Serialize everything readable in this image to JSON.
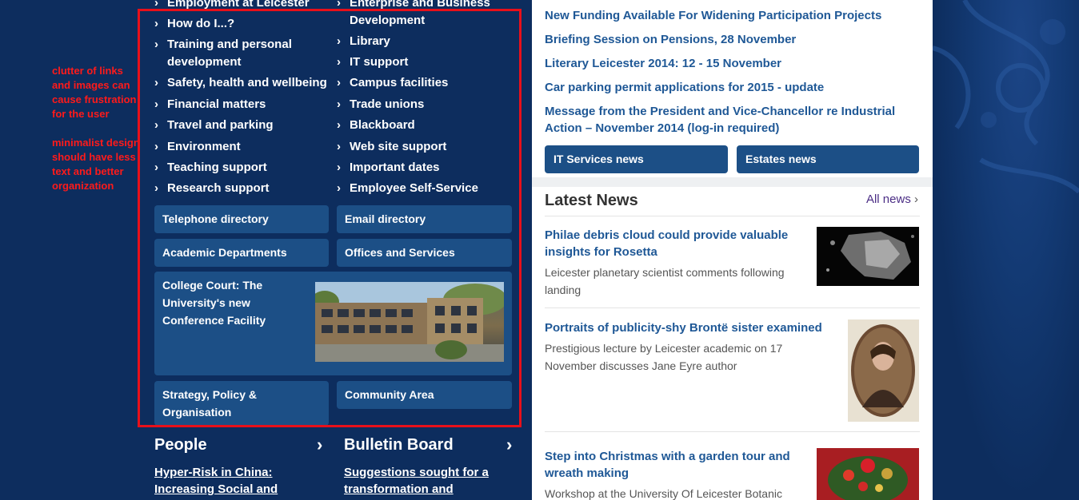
{
  "annotations": {
    "note1": "clutter of links and images can cause frustration for the user",
    "note2": "minimalist design should have less text and better organization"
  },
  "quick_links": {
    "left": [
      "Employment at Leicester",
      "How do I...?",
      "Training and personal development",
      "Safety, health and wellbeing",
      "Financial matters",
      "Travel and parking",
      "Environment",
      "Teaching support",
      "Research support"
    ],
    "right": [
      "Enterprise and Business Development",
      "Library",
      "IT support",
      "Campus facilities",
      "Trade unions",
      "Blackboard",
      "Web site support",
      "Important dates",
      "Employee Self-Service"
    ]
  },
  "tiles": {
    "telephone": "Telephone directory",
    "email": "Email directory",
    "academic": "Academic Departments",
    "offices": "Offices and Services",
    "college_court": "College Court: The University's new Conference Facility",
    "strategy": "Strategy, Policy & Organisation",
    "community": "Community Area"
  },
  "sections": {
    "people_title": "People",
    "people_link": "Hyper-Risk in China: Increasing Social and",
    "bulletin_title": "Bulletin Board",
    "bulletin_link": "Suggestions sought for a transformation and"
  },
  "announcements": [
    "New Funding Available For Widening Participation Projects",
    "Briefing Session on Pensions, 28 November",
    "Literary Leicester 2014: 12 - 15 November",
    "Car parking permit applications for 2015 - update",
    "Message from the President and Vice-Chancellor re Industrial Action – November 2014 (log-in required)"
  ],
  "news_buttons": {
    "it": "IT Services news",
    "estates": "Estates news"
  },
  "latest_news": {
    "title": "Latest News",
    "all_news": "All news",
    "items": [
      {
        "title": "Philae debris cloud could provide valuable insights for Rosetta",
        "desc": "Leicester planetary scientist comments following landing"
      },
      {
        "title": "Portraits of publicity-shy Brontë sister examined",
        "desc": "Prestigious lecture by Leicester academic on 17 November discusses Jane Eyre author"
      },
      {
        "title": "Step into Christmas with a garden tour and wreath making",
        "desc": "Workshop at the University Of Leicester Botanic"
      }
    ]
  },
  "colors": {
    "background": "#0d2d5e",
    "tile": "#1c4f86",
    "link_blue": "#1f5896",
    "annotation_red": "#ff1a1a",
    "highlight_border": "#e8101a"
  }
}
